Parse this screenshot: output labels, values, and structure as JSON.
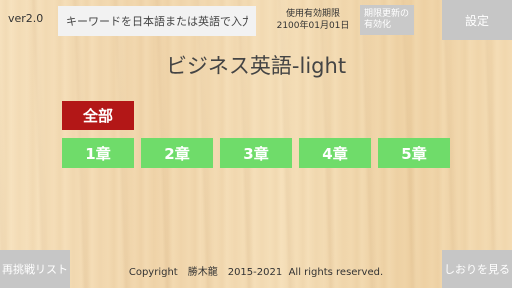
{
  "header": {
    "version": "ver2.0",
    "search_placeholder": "キーワードを日本語または英語で入力",
    "expiry_label": "使用有効期限",
    "expiry_date": "2100年01月01日",
    "renew_label_line1": "期限更新の",
    "renew_label_line2": "有効化",
    "settings_label": "設定"
  },
  "main": {
    "title": "ビジネス英語-light",
    "all_label": "全部",
    "chapters": [
      "1章",
      "2章",
      "3章",
      "4章",
      "5章"
    ]
  },
  "footer": {
    "retry_label": "再挑戦リスト",
    "copyright": "Copyright　勝木龍　2015-2021  All rights reserved.",
    "bookmark_label": "しおりを見る"
  },
  "colors": {
    "all_button": "#b31717",
    "chapter_button": "#6fdc6a",
    "gray_button": "#c6c6c6"
  }
}
